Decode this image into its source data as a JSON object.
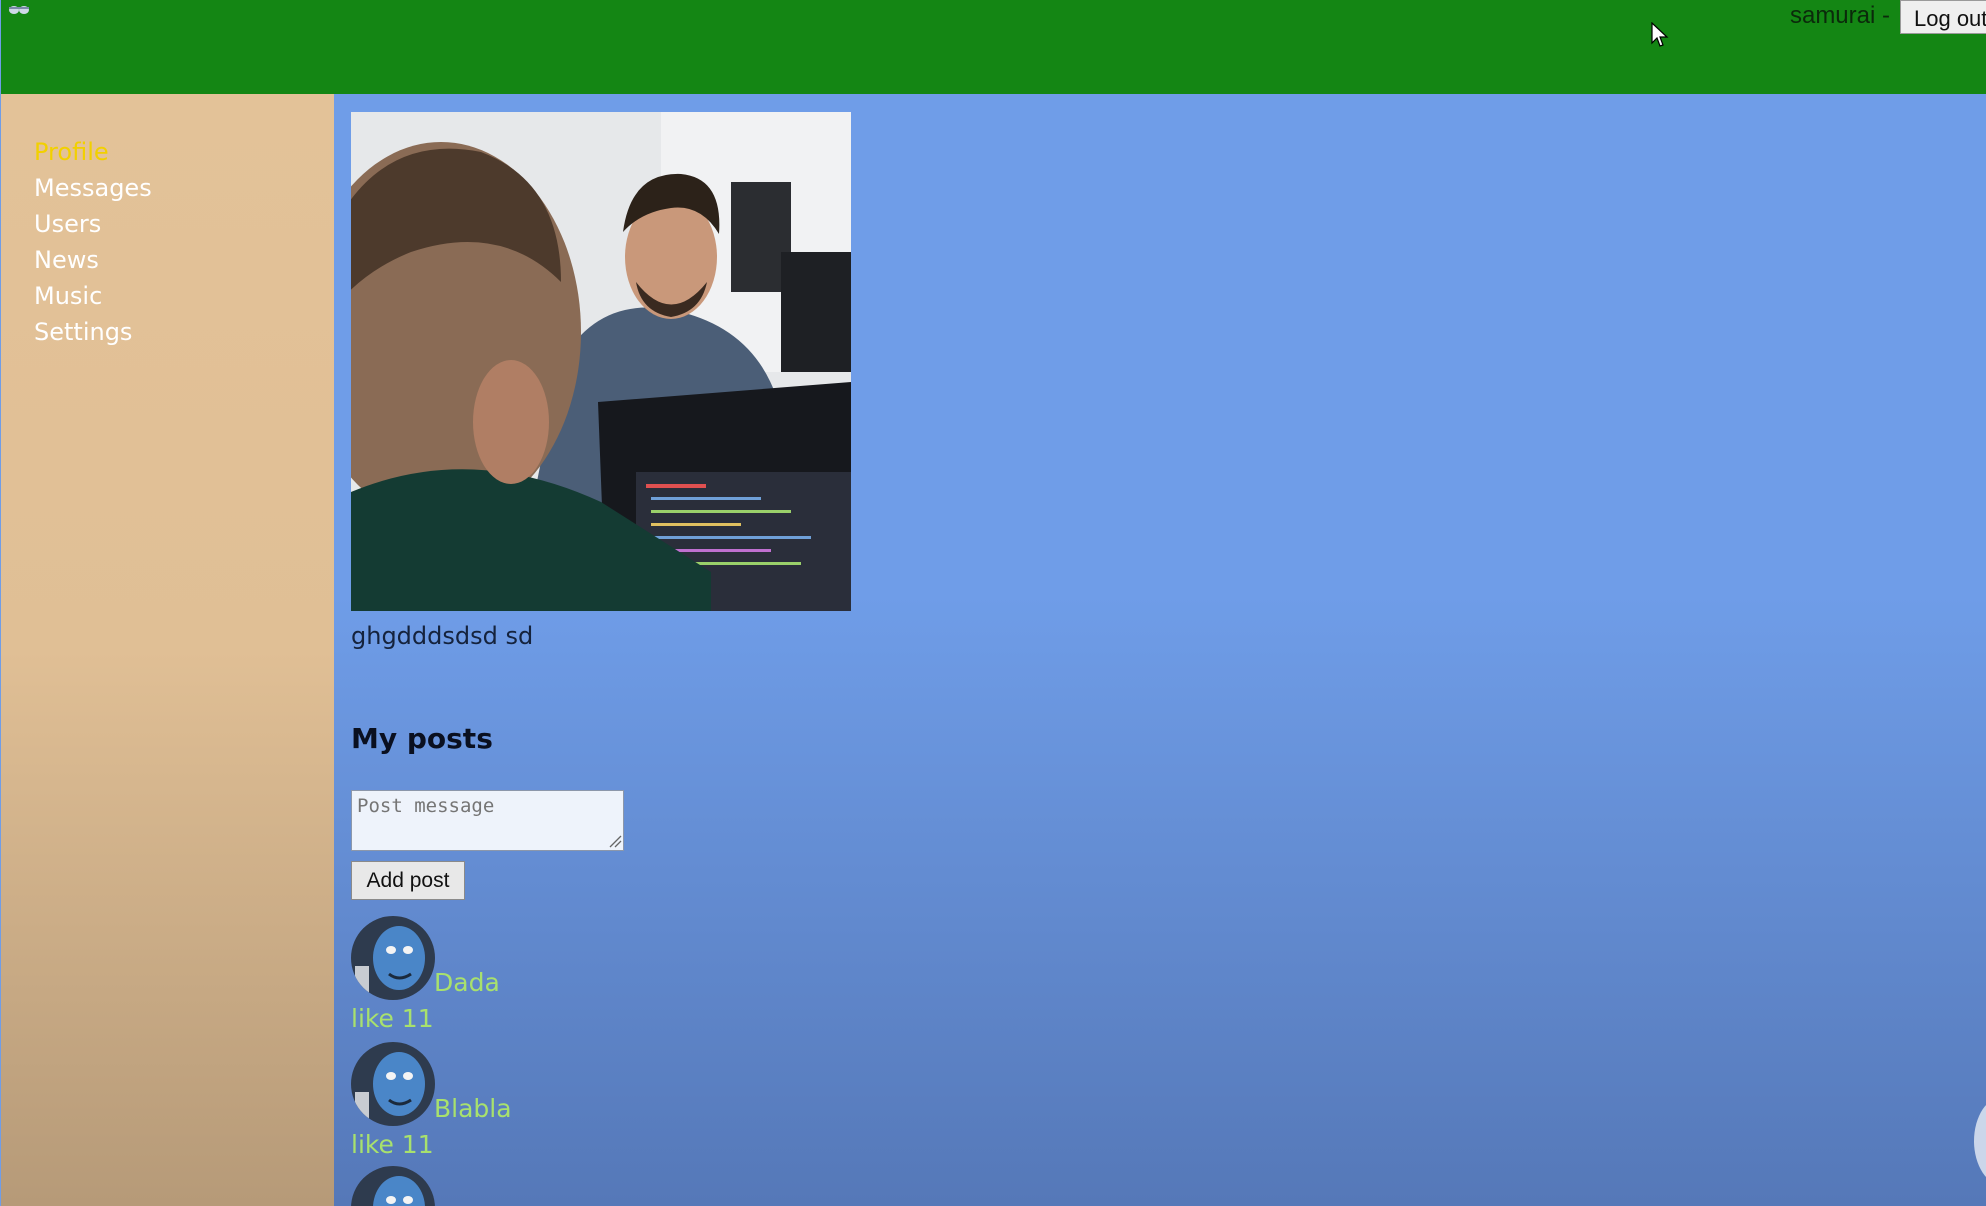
{
  "header": {
    "logo_icon": "app-logo-icon",
    "login": {
      "username_text": "samurai -",
      "logout_label": "Log out"
    }
  },
  "sidebar": {
    "items": [
      {
        "label": "Profile",
        "active": true
      },
      {
        "label": "Messages",
        "active": false
      },
      {
        "label": "Users",
        "active": false
      },
      {
        "label": "News",
        "active": false
      },
      {
        "label": "Music",
        "active": false
      },
      {
        "label": "Settings",
        "active": false
      }
    ]
  },
  "profile": {
    "photo_icon": "profile-photo",
    "status": "ghgdddsdsd sd"
  },
  "posts": {
    "title": "My posts",
    "textarea_placeholder": "Post message",
    "add_button_label": "Add post",
    "items": [
      {
        "message": "Dada",
        "likes_text": "like 11",
        "avatar_icon": "avatar-icon"
      },
      {
        "message": "Blabla",
        "likes_text": "like 11",
        "avatar_icon": "avatar-icon"
      }
    ]
  },
  "colors": {
    "header": "#148614",
    "sidebar": "#e3c298",
    "content": "#6f9de8",
    "active_nav": "#f2d000",
    "post_text": "#a8e16d"
  }
}
